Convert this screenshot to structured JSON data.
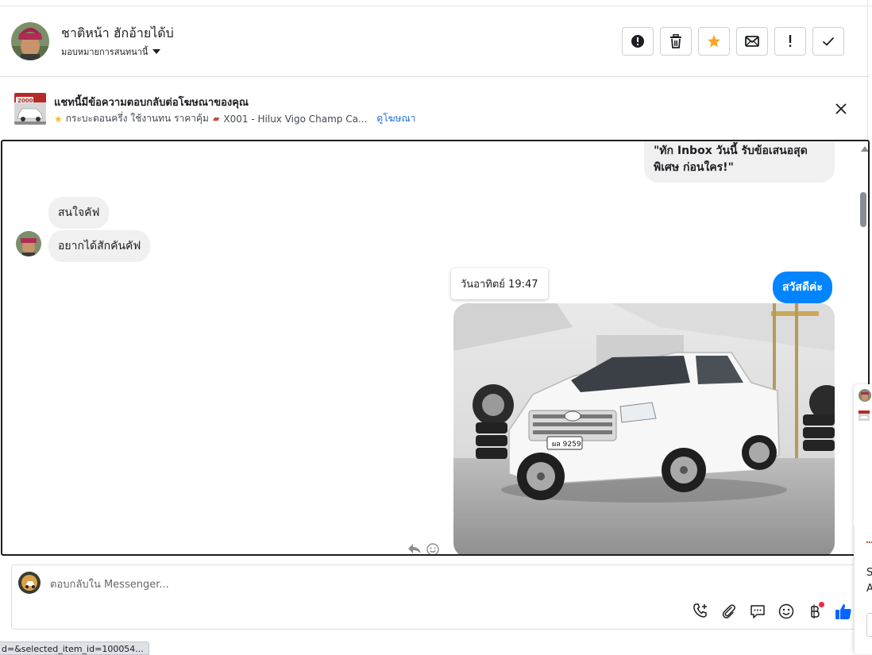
{
  "header": {
    "contact_name": "ชาติหน้า ฮักอ้ายได้บ่",
    "assign_label": "มอบหมายการสนทนานี้"
  },
  "actions": [
    {
      "name": "report",
      "icon": "alert-circle-icon"
    },
    {
      "name": "delete",
      "icon": "trash-icon"
    },
    {
      "name": "star",
      "icon": "star-icon"
    },
    {
      "name": "mark-unread",
      "icon": "envelope-icon"
    },
    {
      "name": "follow-up",
      "icon": "exclamation-icon"
    },
    {
      "name": "mark-done",
      "icon": "checkmark-icon"
    }
  ],
  "ad": {
    "title": "แชทนี้มีข้อความตอบกลับต่อโฆษณาของคุณ",
    "thumb_price": "20000",
    "subtitle_part1": "กระบะตอนครึ่ง ใช้งานทน ราคาคุ้ม",
    "subtitle_part2": "X001 - Hilux Vigo Champ Ca...",
    "view_link": "ดูโฆษณา"
  },
  "messages": {
    "out_promo": "\"ทัก Inbox วันนี้ รับข้อเสนอสุดพิเศษ ก่อนใคร!\"",
    "in_1": "สนใจคัฟ",
    "in_2": "อยากได้สักคันคัฟ",
    "timestamp": "วันอาทิตย์ 19:47",
    "out_greeting": "สวัสดีค่ะ",
    "photo_plate": "ผล 9259"
  },
  "composer": {
    "placeholder": "ตอบกลับใน Messenger..."
  },
  "side_panel": {
    "letter_s": "S",
    "letter_a": "A"
  },
  "status_bar": {
    "url": "d=&selected_item_id=100054..."
  },
  "colors": {
    "accent_blue": "#0084ff",
    "link_blue": "#216fdb",
    "star_orange": "#f5a623",
    "like_blue": "#0866ff",
    "bubble_grey": "#f0f0f0"
  }
}
